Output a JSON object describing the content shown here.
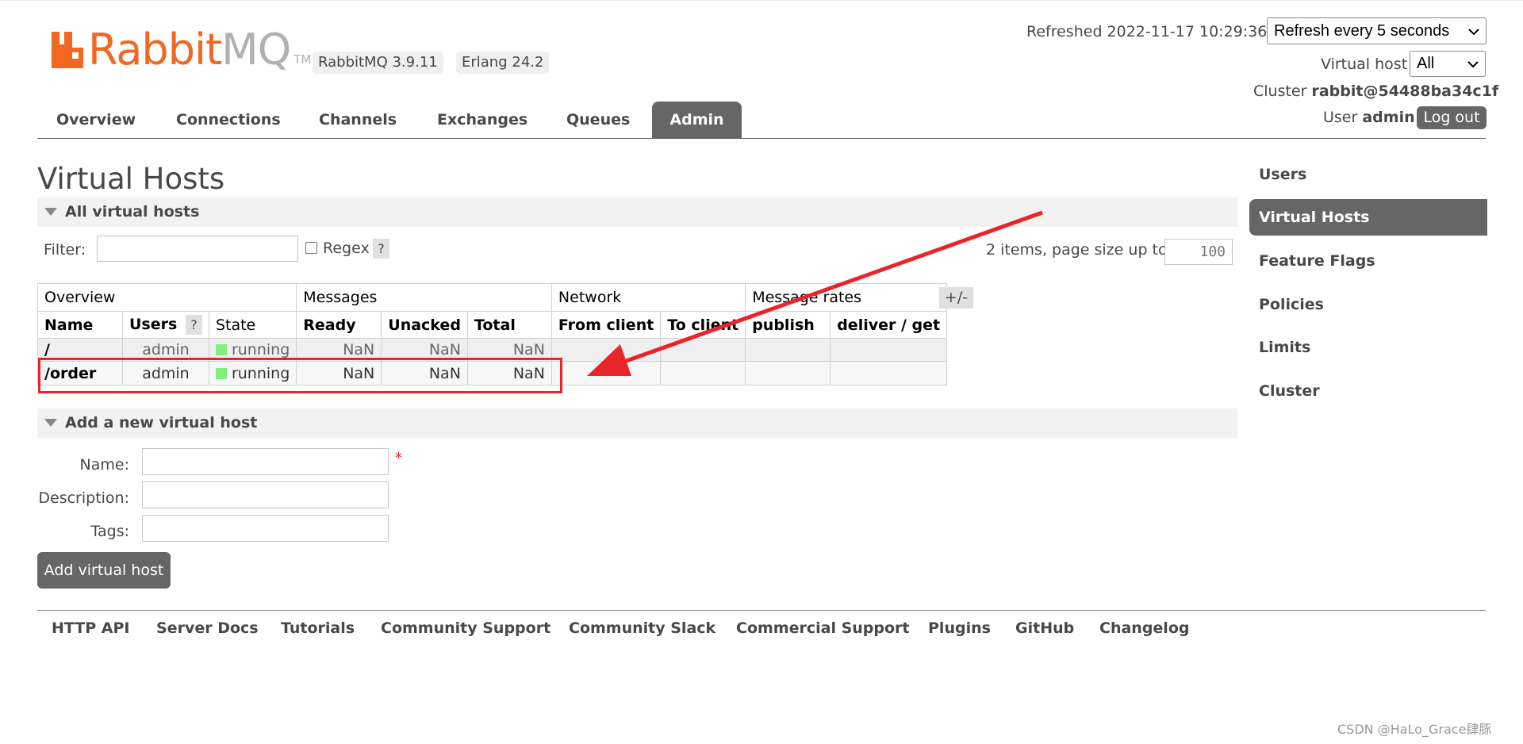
{
  "header": {
    "logo_orange": "Rabbit",
    "logo_grey": "MQ",
    "logo_tm": "TM",
    "version_rabbit": "RabbitMQ 3.9.11",
    "version_erlang": "Erlang 24.2",
    "refreshed_label": "Refreshed 2022-11-17 10:29:36",
    "refresh_select": "Refresh every 5 seconds",
    "vhost_label": "Virtual host",
    "vhost_select": "All",
    "cluster_label": "Cluster",
    "cluster_name": "rabbit@54488ba34c1f",
    "user_label": "User",
    "user_name": "admin",
    "logout": "Log out"
  },
  "nav": {
    "tabs": [
      {
        "label": "Overview"
      },
      {
        "label": "Connections"
      },
      {
        "label": "Channels"
      },
      {
        "label": "Exchanges"
      },
      {
        "label": "Queues"
      },
      {
        "label": "Admin",
        "active": true
      }
    ]
  },
  "sidebar": {
    "items": [
      {
        "label": "Users"
      },
      {
        "label": "Virtual Hosts",
        "active": true
      },
      {
        "label": "Feature Flags"
      },
      {
        "label": "Policies"
      },
      {
        "label": "Limits"
      },
      {
        "label": "Cluster"
      }
    ]
  },
  "main": {
    "title": "Virtual Hosts",
    "all_section": "All virtual hosts",
    "filter_label": "Filter:",
    "filter_value": "",
    "regex_label": "Regex",
    "help": "?",
    "items_text": "2 items, page size up to",
    "page_size": "100",
    "plus_minus": "+/-",
    "table": {
      "groups": [
        "Overview",
        "Messages",
        "Network",
        "Message rates"
      ],
      "headers": [
        "Name",
        "Users",
        "State",
        "Ready",
        "Unacked",
        "Total",
        "From client",
        "To client",
        "publish",
        "deliver / get"
      ],
      "rows": [
        {
          "name": "/",
          "users": "admin",
          "state": "running",
          "ready": "NaN",
          "unacked": "NaN",
          "total": "NaN"
        },
        {
          "name": "/order",
          "users": "admin",
          "state": "running",
          "ready": "NaN",
          "unacked": "NaN",
          "total": "NaN"
        }
      ]
    },
    "add_section": "Add a new virtual host",
    "form": {
      "name_label": "Name:",
      "description_label": "Description:",
      "tags_label": "Tags:",
      "required_mark": "*",
      "submit": "Add virtual host"
    }
  },
  "footer": {
    "links": [
      "HTTP API",
      "Server Docs",
      "Tutorials",
      "Community Support",
      "Community Slack",
      "Commercial Support",
      "Plugins",
      "GitHub",
      "Changelog"
    ]
  },
  "watermark": "CSDN @HaLo_Grace肆豚",
  "colors": {
    "brand_orange": "#f26722",
    "active_grey": "#666666",
    "annotation_red": "#e8252a",
    "running_green": "#80f080"
  }
}
